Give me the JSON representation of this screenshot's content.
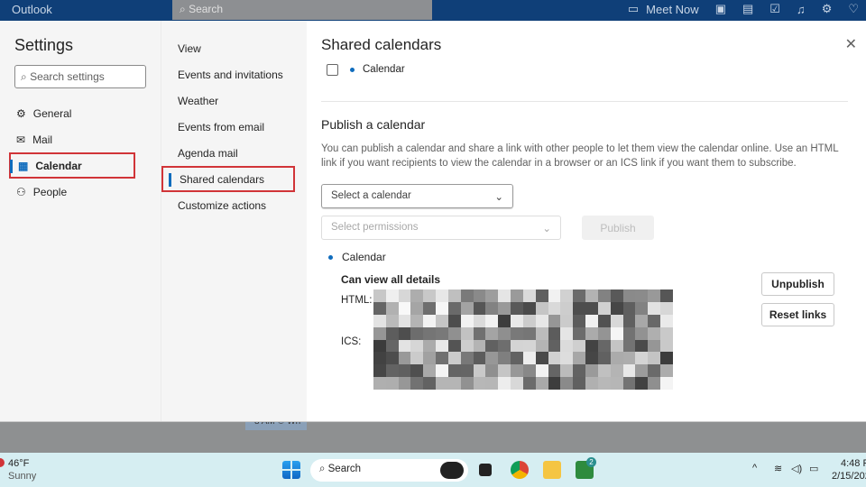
{
  "topbar": {
    "app_title": "Outlook",
    "search_placeholder": "Search",
    "meet_now": "Meet Now"
  },
  "background": {
    "event_chip": "8 AM ⏲ Wh"
  },
  "settings": {
    "title": "Settings",
    "search_placeholder": "Search settings",
    "categories": [
      {
        "label": "General",
        "icon": "gear-icon"
      },
      {
        "label": "Mail",
        "icon": "mail-icon"
      },
      {
        "label": "Calendar",
        "icon": "calendar-icon",
        "selected": true
      },
      {
        "label": "People",
        "icon": "people-icon"
      }
    ],
    "subnav": [
      {
        "label": "View"
      },
      {
        "label": "Events and invitations"
      },
      {
        "label": "Weather"
      },
      {
        "label": "Events from email"
      },
      {
        "label": "Agenda mail"
      },
      {
        "label": "Shared calendars",
        "selected": true
      },
      {
        "label": "Customize actions"
      }
    ]
  },
  "content": {
    "title": "Shared calendars",
    "shared_item": "Calendar",
    "publish_heading": "Publish a calendar",
    "publish_description": "You can publish a calendar and share a link with other people to let them view the calendar online. Use an HTML link if you want recipients to view the calendar in a browser or an ICS link if you want them to subscribe.",
    "select_calendar": "Select a calendar",
    "select_permissions": "Select permissions",
    "publish_button": "Publish",
    "published_calendar": "Calendar",
    "permission": "Can view all details",
    "html_label": "HTML:",
    "ics_label": "ICS:",
    "unpublish_button": "Unpublish",
    "reset_links_button": "Reset links"
  },
  "taskbar": {
    "temperature": "46°F",
    "weather": "Sunny",
    "search": "Search",
    "time": "4:48 P",
    "date": "2/15/202",
    "xbox_badge": "2"
  },
  "colors": {
    "accent": "#0f6cbd",
    "highlight": "#d13438",
    "topbar": "#0f3f78",
    "taskbar": "#d6eef2"
  }
}
